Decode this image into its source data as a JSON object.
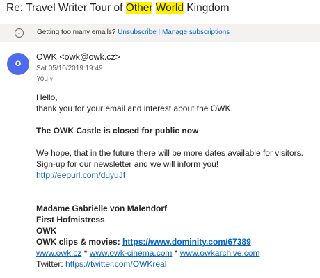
{
  "subject": {
    "prefix": "Re: Travel Writer Tour of ",
    "hl1": "Other",
    "mid": " ",
    "hl2": "World",
    "suffix": " Kingdom"
  },
  "notice": {
    "text": "Getting too many emails?",
    "unsubscribe": "Unsubscribe",
    "separator": "|",
    "manage": "Manage subscriptions"
  },
  "message": {
    "avatar_initial": "O",
    "sender": "OWK <owk@owk.cz>",
    "date": "Sat 05/10/2019 19:49",
    "to": "You"
  },
  "body": {
    "greeting": "Hello,",
    "thanks": "thank you for your email and interest about the OWK.",
    "closed": "The OWK Castle is closed for public now",
    "hope": "We hope, that in the future there will be more dates available for visitors.",
    "signup": "Sign-up for our newsletter and we will inform you!",
    "newsletter_link": "http://eepurl.com/duyuJf",
    "sig_name": "Madame Gabrielle von Malendorf",
    "sig_title": "First Hofmistress",
    "sig_org": "OWK",
    "clips_label": "OWK clips & movies:",
    "clips_link": "https://www.dominity.com/67389",
    "site1": "www.owk.cz",
    "star": "*",
    "site2": "www.owk-cinema.com",
    "site3": "www.owkarchive.com",
    "twitter_label": "Twitter:",
    "twitter_link": "https://twitter.com/OWKreal"
  },
  "colors": {
    "link": "#0563c1",
    "highlight": "#fff100",
    "avatar": "#4f6bed",
    "notice_bg": "#f3f2f1"
  },
  "icons": {
    "info": "info-circle-icon",
    "expand": "chevron-down-icon"
  }
}
